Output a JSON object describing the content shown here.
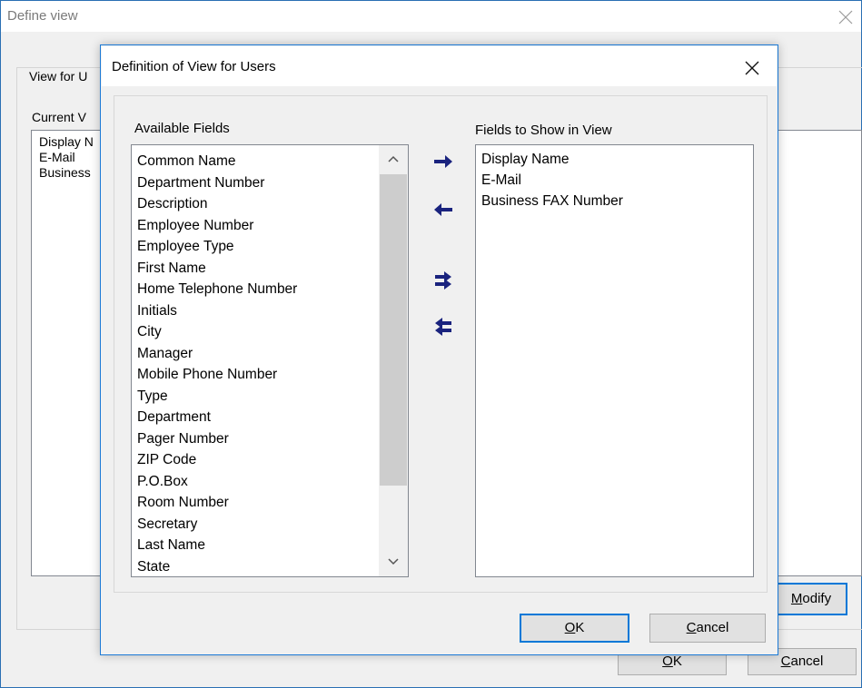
{
  "background_window": {
    "title": "Define view",
    "group_label": "View for U",
    "current_label": "Current V",
    "list_items": [
      "Display N",
      "E-Mail",
      "Business"
    ],
    "modify_button": {
      "accel": "M",
      "rest": "odify"
    },
    "ok_button": {
      "accel": "O",
      "rest": "K"
    },
    "cancel_button": {
      "accel": "C",
      "rest": "ancel"
    }
  },
  "dialog": {
    "title": "Definition of View for Users",
    "available_fields_label": "Available Fields",
    "shown_fields_label": "Fields to Show in View",
    "available_fields": [
      "Common Name",
      "Department Number",
      "Description",
      "Employee Number",
      "Employee Type",
      "First Name",
      "Home Telephone Number",
      "Initials",
      "City",
      "Manager",
      "Mobile Phone Number",
      "Type",
      "Department",
      "Pager Number",
      "ZIP Code",
      "P.O.Box",
      "Room Number",
      "Secretary",
      "Last Name",
      "State"
    ],
    "shown_fields": [
      "Display Name",
      "E-Mail",
      "Business FAX Number"
    ],
    "ok_button": {
      "accel": "O",
      "rest": "K"
    },
    "cancel_button": {
      "accel": "C",
      "rest": "ancel"
    }
  },
  "icons": {
    "close": "close-icon",
    "add": "arrow-right-icon",
    "remove": "arrow-left-icon",
    "add_all": "double-arrow-right-icon",
    "remove_all": "double-arrow-left-icon"
  },
  "colors": {
    "arrow": "#1a237e",
    "focus": "#0078d7",
    "title_border": "#1c7ad6"
  }
}
